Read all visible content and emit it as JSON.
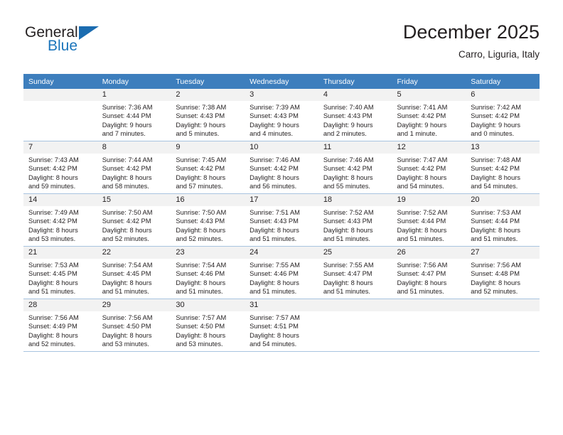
{
  "brand": {
    "name_part1": "General",
    "name_part2": "Blue",
    "logo_icon": "triangle-logo-icon"
  },
  "header": {
    "title": "December 2025",
    "subtitle": "Carro, Liguria, Italy"
  },
  "calendar": {
    "weekday_headers": [
      "Sunday",
      "Monday",
      "Tuesday",
      "Wednesday",
      "Thursday",
      "Friday",
      "Saturday"
    ],
    "colors": {
      "header_bg": "#3d7ebd",
      "header_text": "#ffffff",
      "daynum_band_bg": "#f2f2f2",
      "row_divider": "#a8c4e0",
      "brand_blue": "#1b75bb",
      "text": "#231f20"
    },
    "weeks": [
      [
        {
          "day": "",
          "lines": []
        },
        {
          "day": "1",
          "lines": [
            "Sunrise: 7:36 AM",
            "Sunset: 4:44 PM",
            "Daylight: 9 hours",
            "and 7 minutes."
          ]
        },
        {
          "day": "2",
          "lines": [
            "Sunrise: 7:38 AM",
            "Sunset: 4:43 PM",
            "Daylight: 9 hours",
            "and 5 minutes."
          ]
        },
        {
          "day": "3",
          "lines": [
            "Sunrise: 7:39 AM",
            "Sunset: 4:43 PM",
            "Daylight: 9 hours",
            "and 4 minutes."
          ]
        },
        {
          "day": "4",
          "lines": [
            "Sunrise: 7:40 AM",
            "Sunset: 4:43 PM",
            "Daylight: 9 hours",
            "and 2 minutes."
          ]
        },
        {
          "day": "5",
          "lines": [
            "Sunrise: 7:41 AM",
            "Sunset: 4:42 PM",
            "Daylight: 9 hours",
            "and 1 minute."
          ]
        },
        {
          "day": "6",
          "lines": [
            "Sunrise: 7:42 AM",
            "Sunset: 4:42 PM",
            "Daylight: 9 hours",
            "and 0 minutes."
          ]
        }
      ],
      [
        {
          "day": "7",
          "lines": [
            "Sunrise: 7:43 AM",
            "Sunset: 4:42 PM",
            "Daylight: 8 hours",
            "and 59 minutes."
          ]
        },
        {
          "day": "8",
          "lines": [
            "Sunrise: 7:44 AM",
            "Sunset: 4:42 PM",
            "Daylight: 8 hours",
            "and 58 minutes."
          ]
        },
        {
          "day": "9",
          "lines": [
            "Sunrise: 7:45 AM",
            "Sunset: 4:42 PM",
            "Daylight: 8 hours",
            "and 57 minutes."
          ]
        },
        {
          "day": "10",
          "lines": [
            "Sunrise: 7:46 AM",
            "Sunset: 4:42 PM",
            "Daylight: 8 hours",
            "and 56 minutes."
          ]
        },
        {
          "day": "11",
          "lines": [
            "Sunrise: 7:46 AM",
            "Sunset: 4:42 PM",
            "Daylight: 8 hours",
            "and 55 minutes."
          ]
        },
        {
          "day": "12",
          "lines": [
            "Sunrise: 7:47 AM",
            "Sunset: 4:42 PM",
            "Daylight: 8 hours",
            "and 54 minutes."
          ]
        },
        {
          "day": "13",
          "lines": [
            "Sunrise: 7:48 AM",
            "Sunset: 4:42 PM",
            "Daylight: 8 hours",
            "and 54 minutes."
          ]
        }
      ],
      [
        {
          "day": "14",
          "lines": [
            "Sunrise: 7:49 AM",
            "Sunset: 4:42 PM",
            "Daylight: 8 hours",
            "and 53 minutes."
          ]
        },
        {
          "day": "15",
          "lines": [
            "Sunrise: 7:50 AM",
            "Sunset: 4:42 PM",
            "Daylight: 8 hours",
            "and 52 minutes."
          ]
        },
        {
          "day": "16",
          "lines": [
            "Sunrise: 7:50 AM",
            "Sunset: 4:43 PM",
            "Daylight: 8 hours",
            "and 52 minutes."
          ]
        },
        {
          "day": "17",
          "lines": [
            "Sunrise: 7:51 AM",
            "Sunset: 4:43 PM",
            "Daylight: 8 hours",
            "and 51 minutes."
          ]
        },
        {
          "day": "18",
          "lines": [
            "Sunrise: 7:52 AM",
            "Sunset: 4:43 PM",
            "Daylight: 8 hours",
            "and 51 minutes."
          ]
        },
        {
          "day": "19",
          "lines": [
            "Sunrise: 7:52 AM",
            "Sunset: 4:44 PM",
            "Daylight: 8 hours",
            "and 51 minutes."
          ]
        },
        {
          "day": "20",
          "lines": [
            "Sunrise: 7:53 AM",
            "Sunset: 4:44 PM",
            "Daylight: 8 hours",
            "and 51 minutes."
          ]
        }
      ],
      [
        {
          "day": "21",
          "lines": [
            "Sunrise: 7:53 AM",
            "Sunset: 4:45 PM",
            "Daylight: 8 hours",
            "and 51 minutes."
          ]
        },
        {
          "day": "22",
          "lines": [
            "Sunrise: 7:54 AM",
            "Sunset: 4:45 PM",
            "Daylight: 8 hours",
            "and 51 minutes."
          ]
        },
        {
          "day": "23",
          "lines": [
            "Sunrise: 7:54 AM",
            "Sunset: 4:46 PM",
            "Daylight: 8 hours",
            "and 51 minutes."
          ]
        },
        {
          "day": "24",
          "lines": [
            "Sunrise: 7:55 AM",
            "Sunset: 4:46 PM",
            "Daylight: 8 hours",
            "and 51 minutes."
          ]
        },
        {
          "day": "25",
          "lines": [
            "Sunrise: 7:55 AM",
            "Sunset: 4:47 PM",
            "Daylight: 8 hours",
            "and 51 minutes."
          ]
        },
        {
          "day": "26",
          "lines": [
            "Sunrise: 7:56 AM",
            "Sunset: 4:47 PM",
            "Daylight: 8 hours",
            "and 51 minutes."
          ]
        },
        {
          "day": "27",
          "lines": [
            "Sunrise: 7:56 AM",
            "Sunset: 4:48 PM",
            "Daylight: 8 hours",
            "and 52 minutes."
          ]
        }
      ],
      [
        {
          "day": "28",
          "lines": [
            "Sunrise: 7:56 AM",
            "Sunset: 4:49 PM",
            "Daylight: 8 hours",
            "and 52 minutes."
          ]
        },
        {
          "day": "29",
          "lines": [
            "Sunrise: 7:56 AM",
            "Sunset: 4:50 PM",
            "Daylight: 8 hours",
            "and 53 minutes."
          ]
        },
        {
          "day": "30",
          "lines": [
            "Sunrise: 7:57 AM",
            "Sunset: 4:50 PM",
            "Daylight: 8 hours",
            "and 53 minutes."
          ]
        },
        {
          "day": "31",
          "lines": [
            "Sunrise: 7:57 AM",
            "Sunset: 4:51 PM",
            "Daylight: 8 hours",
            "and 54 minutes."
          ]
        },
        {
          "day": "",
          "lines": []
        },
        {
          "day": "",
          "lines": []
        },
        {
          "day": "",
          "lines": []
        }
      ]
    ]
  }
}
